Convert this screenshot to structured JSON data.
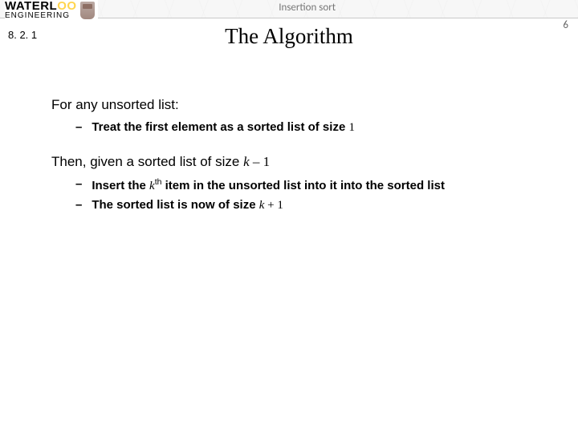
{
  "header": {
    "brand_top_pre": "WATERL",
    "brand_top_mid": "O",
    "brand_top_mid2": "O",
    "brand_bottom": "ENGINEERING",
    "subject": "Insertion sort"
  },
  "page_number": "6",
  "section_number": "8. 2. 1",
  "title": "The Algorithm",
  "body": {
    "p1": "For any unsorted list:",
    "b1a": "Treat the first element as a sorted list of size ",
    "b1_size": "1",
    "p2a": "Then, given a sorted list of size ",
    "p2_var": "k",
    "p2_op": " – ",
    "p2_num": "1",
    "b2a": "Insert the ",
    "b2_var": "k",
    "b2_sup": "th",
    "b2b": " item in the unsorted list into it into the sorted list",
    "b3a": "The sorted list is now of size ",
    "b3_var": "k",
    "b3_op": " + ",
    "b3_num": "1"
  }
}
